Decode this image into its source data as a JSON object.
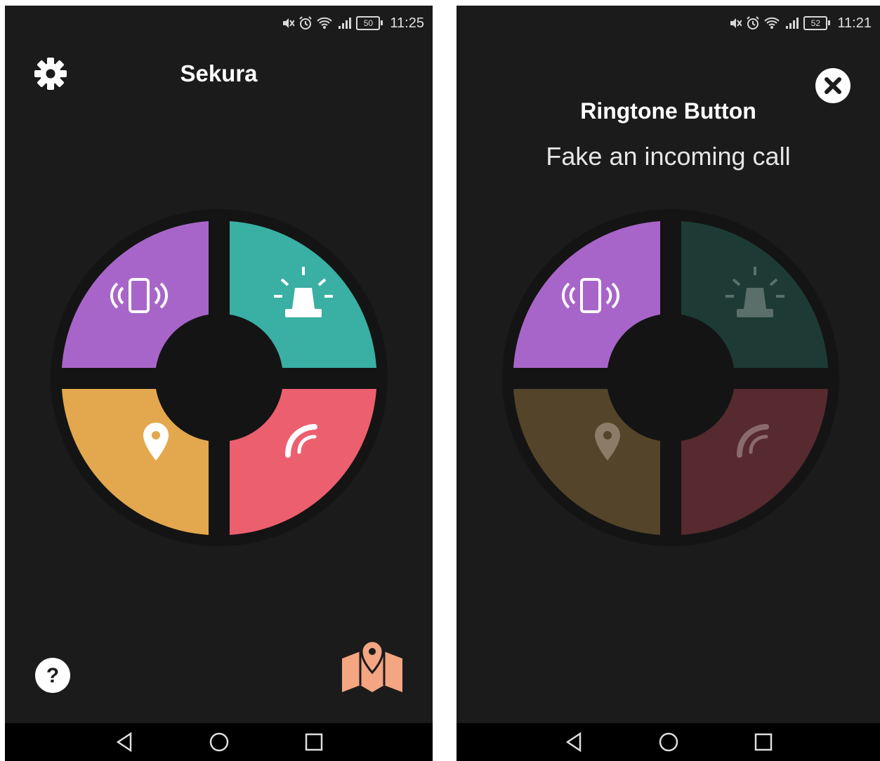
{
  "left_screen": {
    "status": {
      "battery": "50",
      "time": "11:25"
    },
    "title": "Sekura",
    "buttons": {
      "vibrate": {
        "color": "#a865c9"
      },
      "alarm": {
        "color": "#3aafa3"
      },
      "location": {
        "color": "#e3a84d"
      },
      "ringtone": {
        "color": "#ec5f6f"
      }
    },
    "help_icon": "question-icon",
    "map_icon": "map-pin-icon",
    "map_color": "#f4a582"
  },
  "right_screen": {
    "status": {
      "battery": "52",
      "time": "11:21"
    },
    "overlay_title": "Ringtone Button",
    "overlay_subtitle": "Fake an incoming call",
    "buttons": {
      "vibrate": {
        "color": "#a865c9"
      },
      "alarm": {
        "color": "#1d3b34"
      },
      "location": {
        "color": "#54442a"
      },
      "ringtone": {
        "color": "#562a2f"
      }
    }
  },
  "navbar": {
    "back": "back-icon",
    "home": "home-icon",
    "recents": "recents-icon"
  }
}
